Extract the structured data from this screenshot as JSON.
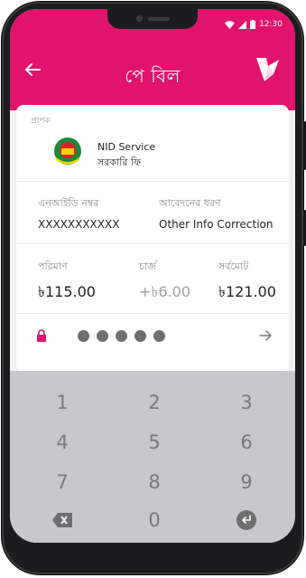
{
  "status_bar": {
    "time": "12:30"
  },
  "toolbar": {
    "title": "পে বিল"
  },
  "recipient": {
    "label": "প্রাপক",
    "name": "NID Service",
    "category": "সরকারি ফি"
  },
  "details": {
    "nid_label": "এনআইডি নম্বর",
    "nid_value": "XXXXXXXXXXX",
    "app_type_label": "আবেদনের ধরণ",
    "app_type_value": "Other Info Correction"
  },
  "amounts": {
    "amount_label": "পরিমাণ",
    "amount_value": "৳115.00",
    "charge_label": "চার্জ",
    "charge_value": "+৳6.00",
    "total_label": "সর্বমোট",
    "total_value": "৳121.00"
  },
  "pin": {
    "filled_count": 5
  },
  "keypad": {
    "keys": [
      "1",
      "2",
      "3",
      "4",
      "5",
      "6",
      "7",
      "8",
      "9",
      "0"
    ]
  },
  "colors": {
    "brand": "#e2136e",
    "keypad_bg": "#c7c7cc"
  },
  "icons": [
    "back-arrow-icon",
    "bird-logo-icon",
    "wifi-icon",
    "signal-icon",
    "battery-icon",
    "nid-emblem-icon",
    "lock-icon",
    "forward-arrow-icon",
    "backspace-icon",
    "enter-icon"
  ]
}
